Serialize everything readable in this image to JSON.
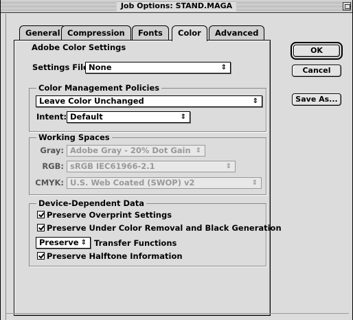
{
  "window": {
    "title": "Job Options: STAND.MAGA"
  },
  "tabs": [
    "General",
    "Compression",
    "Fonts",
    "Color",
    "Advanced"
  ],
  "active_tab": "Color",
  "adobe_color_settings": {
    "heading": "Adobe Color Settings",
    "settings_file_label": "Settings File:",
    "settings_file_value": "None"
  },
  "color_management": {
    "heading": "Color Management Policies",
    "policy_value": "Leave Color Unchanged",
    "intent_label": "Intent:",
    "intent_value": "Default"
  },
  "working_spaces": {
    "heading": "Working Spaces",
    "gray_label": "Gray:",
    "gray_value": "Adobe Gray - 20% Dot Gain",
    "rgb_label": "RGB:",
    "rgb_value": "sRGB IEC61966-2.1",
    "cmyk_label": "CMYK:",
    "cmyk_value": "U.S. Web Coated (SWOP) v2"
  },
  "device_dependent": {
    "heading": "Device-Dependent Data",
    "preserve_overprint": "Preserve Overprint Settings",
    "preserve_ucr": "Preserve Under Color Removal and Black Generation",
    "transfer_select_value": "Preserve",
    "transfer_label": "Transfer Functions",
    "preserve_halftone": "Preserve Halftone Information"
  },
  "buttons": {
    "ok": "OK",
    "cancel": "Cancel",
    "save_as": "Save As..."
  },
  "icons": {
    "popup_arrows": "⇕",
    "zoom": "zoom-box-icon"
  }
}
